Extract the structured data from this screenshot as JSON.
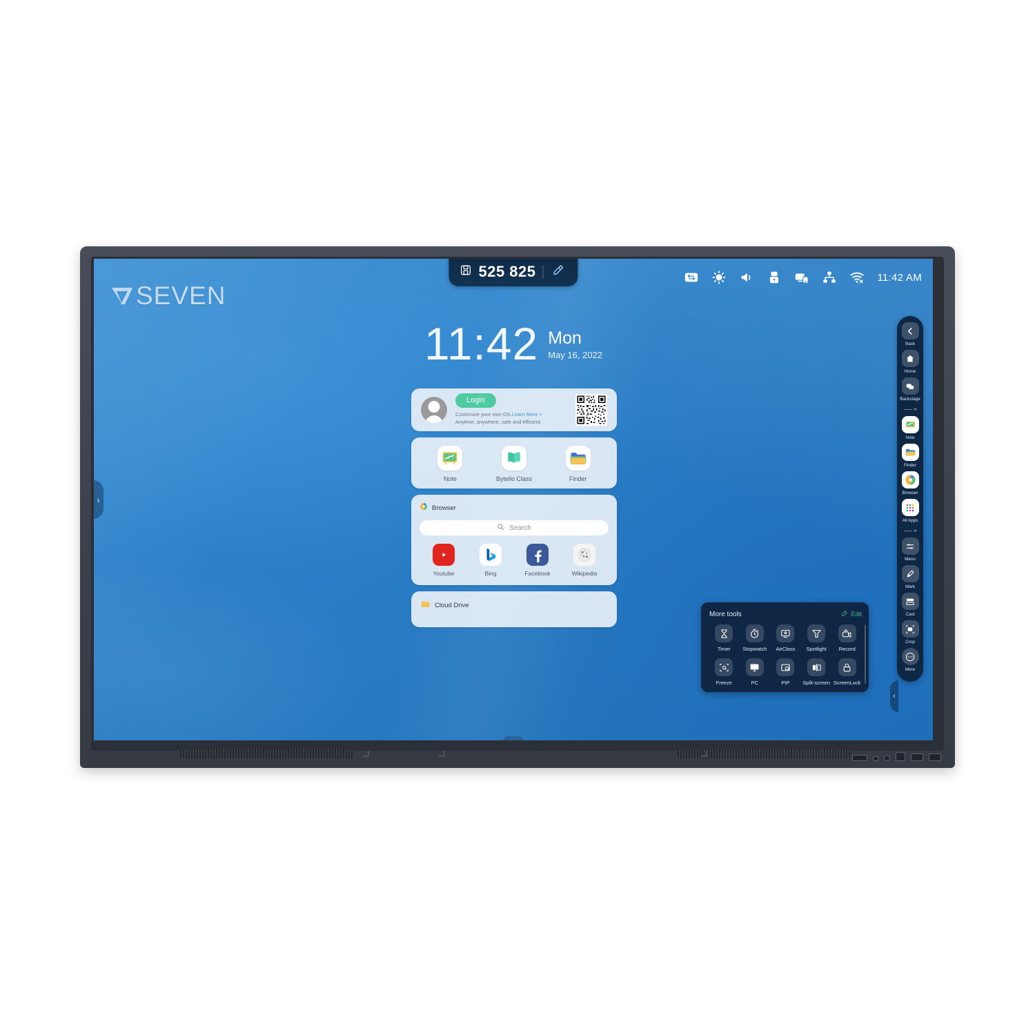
{
  "device": {
    "brand_logo_text": "SEVEN",
    "logo_mark": "v7-logo-icon"
  },
  "topbar": {
    "device_id": "525 825",
    "id_icon": "screen-share-id-icon",
    "pen_icon": "pen-eraser-icon",
    "status_icons": [
      {
        "name": "input-source-icon",
        "glyph": "swap"
      },
      {
        "name": "brightness-icon",
        "glyph": "sun"
      },
      {
        "name": "volume-icon",
        "glyph": "speaker"
      },
      {
        "name": "usb-icon",
        "glyph": "usb"
      },
      {
        "name": "screen-share-icon",
        "glyph": "cast"
      },
      {
        "name": "network-icon",
        "glyph": "lan"
      },
      {
        "name": "wifi-off-icon",
        "glyph": "wifi-x"
      }
    ],
    "time": "11:42 AM"
  },
  "clock": {
    "time": "11:42",
    "weekday": "Mon",
    "date": "May 16, 2022"
  },
  "login_card": {
    "button_label": "Login",
    "line1_prefix": "Customize your own OS.",
    "line1_link": "Learn More >",
    "line2": "Anytime, anywhere, safe and efficient.",
    "avatar": "user-avatar",
    "qr": "login-qr-code"
  },
  "apps_card": {
    "items": [
      {
        "label": "Note",
        "icon": "note-whiteboard-icon"
      },
      {
        "label": "Bytello Class",
        "icon": "bytello-class-book-icon"
      },
      {
        "label": "Finder",
        "icon": "finder-folder-icon"
      }
    ]
  },
  "browser_card": {
    "title": "Browser",
    "title_icon": "browser-globe-icon",
    "search_placeholder": "Search",
    "search_value": "",
    "search_icon": "search-icon",
    "bookmarks": [
      {
        "label": "Youtube",
        "icon": "youtube-icon",
        "color": "#e0241f"
      },
      {
        "label": "Bing",
        "icon": "bing-icon",
        "color": "#ffffff"
      },
      {
        "label": "Facebook",
        "icon": "facebook-icon",
        "color": "#3b5998"
      },
      {
        "label": "Wikipedia",
        "icon": "wikipedia-icon",
        "color": "#f2f2f2"
      }
    ]
  },
  "cloud_card": {
    "title": "Cloud Drive",
    "title_icon": "cloud-drive-folder-icon"
  },
  "more_tools": {
    "title": "More tools",
    "edit_label": "Edit",
    "edit_icon": "edit-pencil-icon",
    "items": [
      {
        "label": "Timer",
        "icon": "hourglass-timer-icon"
      },
      {
        "label": "Stopwatch",
        "icon": "stopwatch-icon"
      },
      {
        "label": "AirClass",
        "icon": "airclass-screen-icon"
      },
      {
        "label": "Spotlight",
        "icon": "spotlight-icon"
      },
      {
        "label": "Record",
        "icon": "record-camera-icon"
      },
      {
        "label": "Freeze",
        "icon": "freeze-zoom-icon"
      },
      {
        "label": "PC",
        "icon": "pc-monitor-icon"
      },
      {
        "label": "PIP",
        "icon": "pip-icon"
      },
      {
        "label": "Split-screen",
        "icon": "split-screen-icon"
      },
      {
        "label": "ScreenLock",
        "icon": "screenlock-padlock-icon"
      }
    ]
  },
  "sidebar": {
    "groups": [
      {
        "items": [
          {
            "label": "Back",
            "icon": "back-chevron-icon",
            "style": "gray"
          },
          {
            "label": "Home",
            "icon": "home-icon",
            "style": "gray"
          },
          {
            "label": "Backstage",
            "icon": "backstage-windows-icon",
            "style": "gray"
          }
        ]
      },
      {
        "items": [
          {
            "label": "Note",
            "icon": "note-whiteboard-icon",
            "style": "white"
          },
          {
            "label": "Finder",
            "icon": "finder-folder-icon",
            "style": "white"
          },
          {
            "label": "Browser",
            "icon": "browser-globe-icon",
            "style": "white"
          },
          {
            "label": "All Apps",
            "icon": "all-apps-grid-icon",
            "style": "white"
          }
        ]
      },
      {
        "items": [
          {
            "label": "Menu",
            "icon": "menu-icon",
            "style": "gray"
          },
          {
            "label": "Mark",
            "icon": "mark-pen-icon",
            "style": "gray"
          },
          {
            "label": "Cast",
            "icon": "cast-icon",
            "style": "gray"
          },
          {
            "label": "Crop",
            "icon": "crop-icon",
            "style": "gray"
          },
          {
            "label": "More",
            "icon": "more-dots-icon",
            "style": "gray"
          }
        ]
      }
    ],
    "divider_chevrons": "›››"
  },
  "edges": {
    "left_handle": "›",
    "right_handle": "‹"
  },
  "colors": {
    "screen_blue": "#2b80c9",
    "panel_navy": "#0f2744",
    "accent_green": "#4ecba0",
    "card_bg": "#e8f0f8"
  }
}
